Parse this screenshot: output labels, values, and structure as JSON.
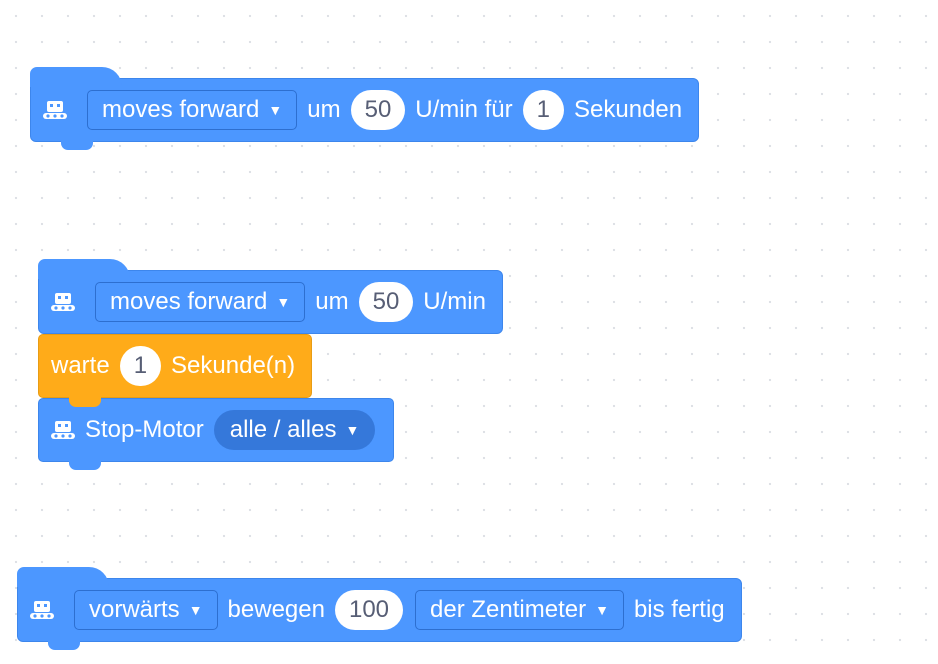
{
  "block1": {
    "direction": "moves forward",
    "um": "um",
    "speed": "50",
    "unit": "U/min für",
    "duration": "1",
    "seconds": "Sekunden"
  },
  "block2": {
    "direction": "moves forward",
    "um": "um",
    "speed": "50",
    "unit": "U/min"
  },
  "wait": {
    "label": "warte",
    "value": "1",
    "unit": "Sekunde(n)"
  },
  "stop": {
    "label": "Stop-Motor",
    "target": "alle / alles"
  },
  "block3": {
    "direction": "vorwärts",
    "move": "bewegen",
    "distance": "100",
    "unit": "der Zentimeter",
    "until": "bis fertig"
  },
  "caret": "▼",
  "icon": "robot-icon",
  "colors": {
    "motion_blue": "#4c97ff",
    "control_orange": "#ffab19",
    "number_text": "#575e75"
  }
}
